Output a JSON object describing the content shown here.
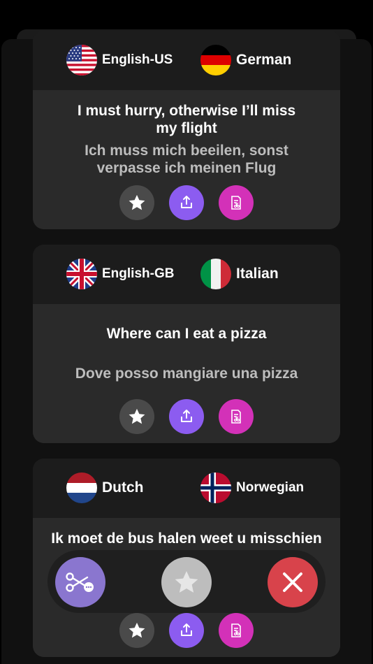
{
  "cards": [
    {
      "source_lang": "English-US",
      "target_lang": "German",
      "source_flag": "us-flag-icon",
      "target_flag": "germany-flag-icon",
      "source_lines": [
        "I must hurry, otherwise I’ll miss",
        "my flight"
      ],
      "target_lines": [
        "Ich muss mich beeilen, sonst",
        "verpasse ich meinen Flug"
      ]
    },
    {
      "source_lang": "English-GB",
      "target_lang": "Italian",
      "source_flag": "uk-flag-icon",
      "target_flag": "italy-flag-icon",
      "source_lines": [
        "Where can I eat a pizza"
      ],
      "target_lines": [
        "Dove posso mangiare una pizza"
      ]
    },
    {
      "source_lang": "Dutch",
      "target_lang": "Norwegian",
      "source_flag": "netherlands-flag-icon",
      "target_flag": "norway-flag-icon",
      "source_lines": [
        "Ik moet de bus halen weet u misschien"
      ],
      "target_lines": []
    }
  ],
  "card_actions": [
    "favorite-star-icon",
    "share-icon",
    "note-cut-icon"
  ],
  "floating_bar": {
    "left_icon": "scissors-more-icon",
    "center_icon": "star-icon",
    "right_icon": "close-icon"
  },
  "colors": {
    "share": "#8c5cf0",
    "note": "#d331b8",
    "cut_fab": "#8a76cf",
    "close_fab": "#d8434b",
    "star_fab": "#bdbdbd"
  }
}
